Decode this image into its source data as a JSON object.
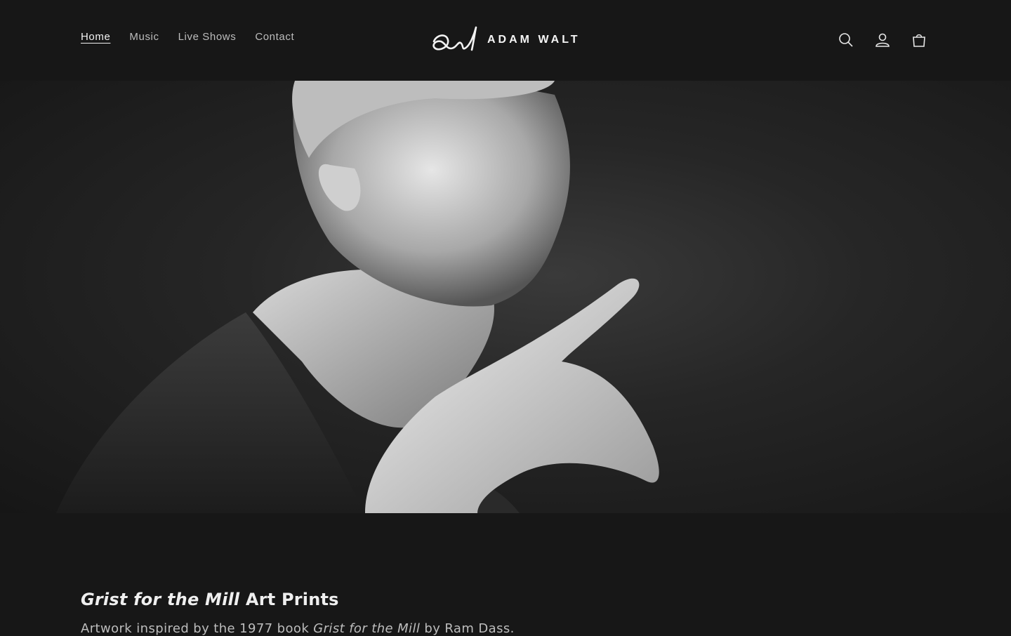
{
  "header": {
    "nav": [
      {
        "label": "Home",
        "active": true
      },
      {
        "label": "Music",
        "active": false
      },
      {
        "label": "Live Shows",
        "active": false
      },
      {
        "label": "Contact",
        "active": false
      }
    ],
    "brand": "ADAM WALT",
    "icons": [
      "search-icon",
      "account-icon",
      "cart-icon"
    ]
  },
  "hero": {
    "image": "black-and-white portrait of man with raised hand"
  },
  "content": {
    "heading_italic": "Grist for the Mill",
    "heading_rest": " Art Prints",
    "sub_prefix": "Artwork inspired by the 1977 book ",
    "sub_italic": "Grist for the Mill",
    "sub_suffix": " by Ram Dass."
  },
  "colors": {
    "background": "#171717",
    "text": "#e8e8e8",
    "muted": "#bdbdbd"
  }
}
